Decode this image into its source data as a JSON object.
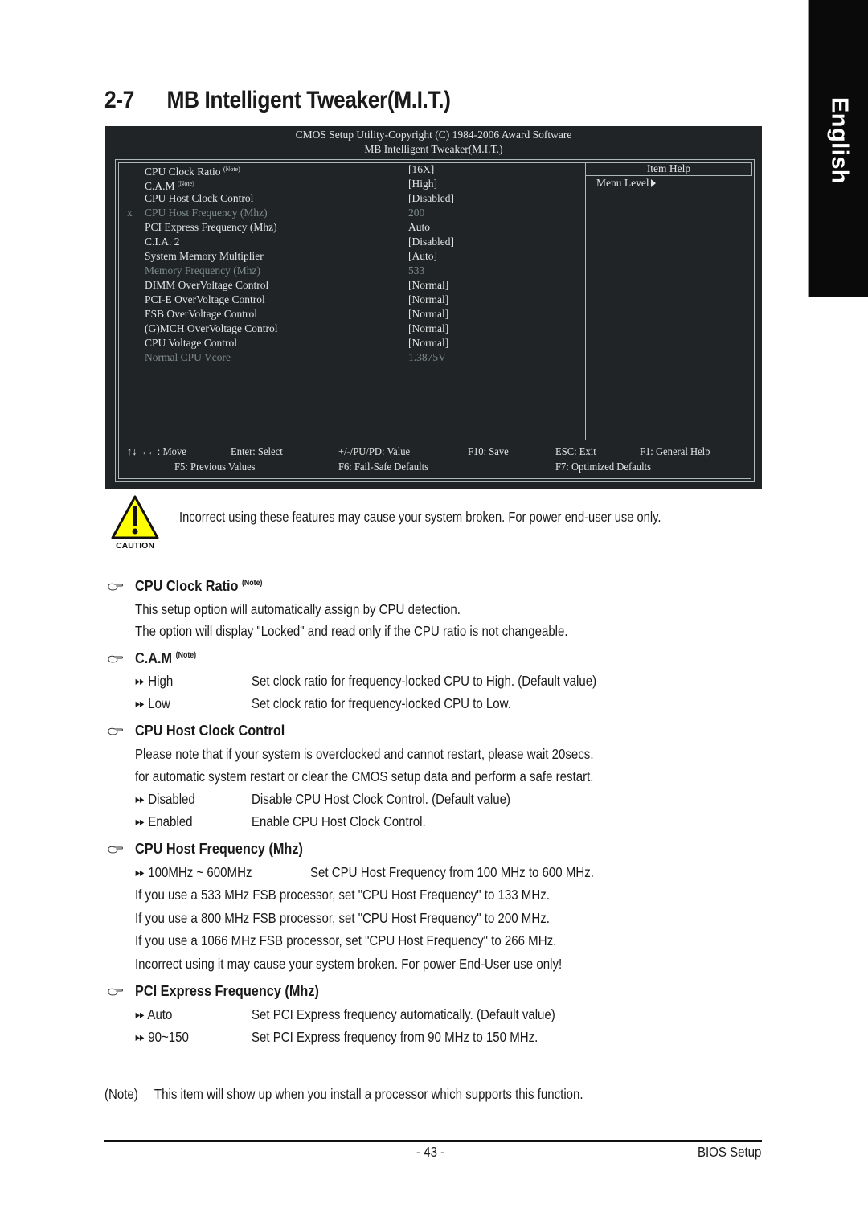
{
  "side_tab": {
    "label": "English"
  },
  "section": {
    "number": "2-7",
    "title": "MB Intelligent Tweaker(M.I.T.)"
  },
  "bios": {
    "header_line1": "CMOS Setup Utility-Copyright (C) 1984-2006 Award Software",
    "header_line2": "MB Intelligent Tweaker(M.I.T.)",
    "help_title": "Item Help",
    "help_menu_level": "Menu Level",
    "note_sup": "(Note)",
    "items": [
      {
        "mark": "",
        "label": "CPU Clock Ratio",
        "note": "(Note)",
        "value": "[16X]",
        "dim": false
      },
      {
        "mark": "",
        "label": "C.A.M",
        "note": "(Note)",
        "value": "[High]",
        "dim": false
      },
      {
        "mark": "",
        "label": "CPU Host Clock Control",
        "note": "",
        "value": "[Disabled]",
        "dim": false
      },
      {
        "mark": "x",
        "label": "CPU Host Frequency (Mhz)",
        "note": "",
        "value": "200",
        "dim": true
      },
      {
        "mark": "",
        "label": "PCI Express Frequency (Mhz)",
        "note": "",
        "value": "Auto",
        "dim": false
      },
      {
        "mark": "",
        "label": "C.I.A. 2",
        "note": "",
        "value": "[Disabled]",
        "dim": false
      },
      {
        "mark": "",
        "label": "System Memory Multiplier",
        "note": "",
        "value": "[Auto]",
        "dim": false
      },
      {
        "mark": "",
        "label": "Memory Frequency (Mhz)",
        "note": "",
        "value": "533",
        "dim": true
      },
      {
        "mark": "",
        "label": "DIMM OverVoltage Control",
        "note": "",
        "value": "[Normal]",
        "dim": false
      },
      {
        "mark": "",
        "label": "PCI-E OverVoltage Control",
        "note": "",
        "value": "[Normal]",
        "dim": false
      },
      {
        "mark": "",
        "label": "FSB OverVoltage Control",
        "note": "",
        "value": "[Normal]",
        "dim": false
      },
      {
        "mark": "",
        "label": "(G)MCH OverVoltage Control",
        "note": "",
        "value": "[Normal]",
        "dim": false
      },
      {
        "mark": "",
        "label": "CPU Voltage Control",
        "note": "",
        "value": "[Normal]",
        "dim": false
      },
      {
        "mark": "",
        "label": "Normal CPU Vcore",
        "note": "",
        "value": "1.3875V",
        "dim": true
      }
    ],
    "keys": {
      "move": "↑↓→←: Move",
      "enter": "Enter: Select",
      "value": "+/-/PU/PD: Value",
      "save": "F10: Save",
      "exit": "ESC: Exit",
      "help": "F1: General Help",
      "prev": "F5: Previous Values",
      "failsafe": "F6: Fail-Safe Defaults",
      "optimized": "F7: Optimized Defaults"
    }
  },
  "caution": {
    "badge": "CAUTION",
    "text": "Incorrect using these features may cause your system broken. For power end-user use only."
  },
  "sections": {
    "cpu_clock_ratio": {
      "title": "CPU Clock Ratio",
      "note": "(Note)",
      "lines": [
        "This setup option will automatically assign by CPU detection.",
        "The option will display \"Locked\" and read only if the CPU ratio is not changeable."
      ]
    },
    "cam": {
      "title": "C.A.M",
      "note": "(Note)",
      "options": [
        {
          "key": "High",
          "desc": "Set clock ratio for frequency-locked CPU to High. (Default value)"
        },
        {
          "key": "Low",
          "desc": "Set clock ratio for frequency-locked CPU to Low."
        }
      ]
    },
    "cpu_host_clock": {
      "title": "CPU Host Clock Control",
      "lines": [
        "Please note that if your system is overclocked and cannot restart, please wait 20secs.",
        "for automatic system restart or clear the CMOS setup data and perform a safe restart."
      ],
      "options": [
        {
          "key": "Disabled",
          "desc": "Disable CPU Host Clock Control. (Default value)"
        },
        {
          "key": "Enabled",
          "desc": "Enable CPU Host Clock Control."
        }
      ]
    },
    "cpu_host_freq": {
      "title": "CPU Host Frequency (Mhz)",
      "options": [
        {
          "key": "100MHz ~ 600MHz",
          "desc": "Set CPU Host Frequency from 100 MHz to 600 MHz."
        }
      ],
      "lines": [
        "If you use a 533 MHz FSB processor, set \"CPU Host Frequency\" to 133 MHz.",
        "If you use a 800 MHz FSB processor, set \"CPU Host Frequency\" to 200 MHz.",
        "If you use a 1066 MHz FSB processor, set \"CPU Host Frequency\" to 266 MHz.",
        "Incorrect using it may cause your system broken. For power End-User use only!"
      ]
    },
    "pcie_freq": {
      "title": "PCI Express Frequency (Mhz)",
      "options": [
        {
          "key": "Auto",
          "desc": "Set PCI Express frequency automatically. (Default value)"
        },
        {
          "key": "90~150",
          "desc": "Set PCI Express frequency from 90 MHz to 150 MHz."
        }
      ]
    }
  },
  "footnote": {
    "label": "(Note)",
    "text": "This item will show up when you install a processor which supports this function."
  },
  "footer": {
    "page": "- 43 -",
    "title": "BIOS Setup"
  },
  "icons": {
    "bullet": "pointing-hand-icon",
    "option": "double-arrow-icon",
    "caution": "caution-triangle-icon"
  },
  "colors": {
    "bios_bg": "#212426",
    "bios_text": "#e2e4e4",
    "bios_dim": "#7d8c89",
    "caution_yellow": "#ffff00"
  }
}
